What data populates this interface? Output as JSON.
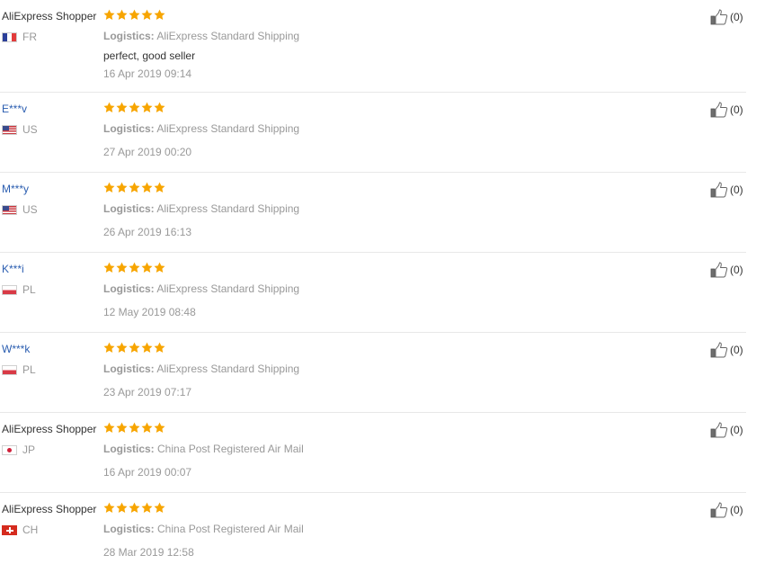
{
  "reviews": [
    {
      "name": "AliExpress Shopper",
      "name_style": "plain",
      "country": "FR",
      "flag": "fr",
      "rating": 5,
      "logistics_label": "Logistics:",
      "logistics": "AliExpress Standard Shipping",
      "comment": "perfect, good seller",
      "date": "16 Apr 2019 09:14",
      "helpful": "(0)"
    },
    {
      "name": "E***v",
      "name_style": "link",
      "country": "US",
      "flag": "us",
      "rating": 5,
      "logistics_label": "Logistics:",
      "logistics": "AliExpress Standard Shipping",
      "comment": "",
      "date": "27 Apr 2019 00:20",
      "helpful": "(0)"
    },
    {
      "name": "M***y",
      "name_style": "link",
      "country": "US",
      "flag": "us",
      "rating": 5,
      "logistics_label": "Logistics:",
      "logistics": "AliExpress Standard Shipping",
      "comment": "",
      "date": "26 Apr 2019 16:13",
      "helpful": "(0)"
    },
    {
      "name": "K***i",
      "name_style": "link",
      "country": "PL",
      "flag": "pl",
      "rating": 5,
      "logistics_label": "Logistics:",
      "logistics": "AliExpress Standard Shipping",
      "comment": "",
      "date": "12 May 2019 08:48",
      "helpful": "(0)"
    },
    {
      "name": "W***k",
      "name_style": "link",
      "country": "PL",
      "flag": "pl",
      "rating": 5,
      "logistics_label": "Logistics:",
      "logistics": "AliExpress Standard Shipping",
      "comment": "",
      "date": "23 Apr 2019 07:17",
      "helpful": "(0)"
    },
    {
      "name": "AliExpress Shopper",
      "name_style": "plain",
      "country": "JP",
      "flag": "jp",
      "rating": 5,
      "logistics_label": "Logistics:",
      "logistics": "China Post Registered Air Mail",
      "comment": "",
      "date": "16 Apr 2019 00:07",
      "helpful": "(0)"
    },
    {
      "name": "AliExpress Shopper",
      "name_style": "plain",
      "country": "CH",
      "flag": "ch",
      "rating": 5,
      "logistics_label": "Logistics:",
      "logistics": "China Post Registered Air Mail",
      "comment": "",
      "date": "28 Mar 2019 12:58",
      "helpful": "(0)"
    }
  ],
  "icons": {
    "star": "star-icon",
    "helpful": "thumbs-up-icon"
  },
  "colors": {
    "star": "#f7a500",
    "username_link": "#2a5db0",
    "muted_text": "#999999",
    "divider": "#e8e8e8"
  }
}
